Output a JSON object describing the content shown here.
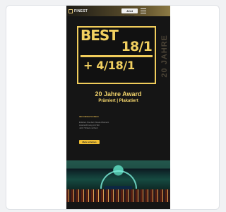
{
  "app": {
    "logo_text": "FINEST",
    "top_cta": "Jetzt buchen"
  },
  "hero": {
    "best": "BEST",
    "fraction": "18/1",
    "plus_line": "+ 4/18/1",
    "vertical_text": "20 JAHRE"
  },
  "content": {
    "award_title": "20 Jahre Award",
    "award_subtitle": "Prämiert | Plakatiert",
    "section_label": "INFORMATIONEN",
    "info_lines": [
      "Erleben Sie den Finest-Moment",
      "Auszeichnung mit Stil",
      "Jetzt Tickets sichern"
    ],
    "primary_button": "Mehr erfahren"
  },
  "colors": {
    "background": "#f1f2f4",
    "card": "#ffffff",
    "phone": "#151515",
    "gold": "#f2d060"
  },
  "icons": {
    "menu": "hamburger-menu-icon",
    "logo_mark": "logo-mark-icon"
  }
}
